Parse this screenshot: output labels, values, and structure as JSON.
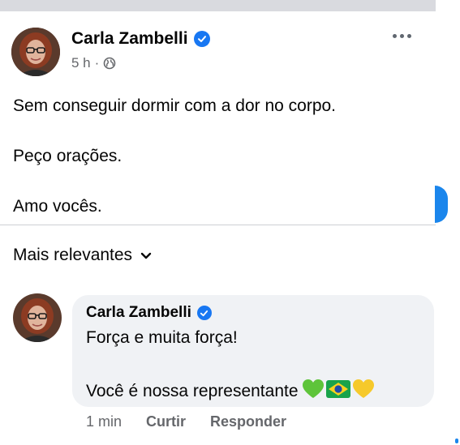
{
  "post": {
    "author": "Carla Zambelli",
    "time": "5 h",
    "separator": "·",
    "lines": [
      "Sem conseguir dormir com a dor no corpo.",
      "Peço orações.",
      "Amo vocês."
    ]
  },
  "comments": {
    "sort_label": "Mais relevantes"
  },
  "comment": {
    "author": "Carla Zambelli",
    "line1": "Força e muita força!",
    "line2": "Você é nossa representante",
    "time": "1 min",
    "like_label": "Curtir",
    "reply_label": "Responder"
  },
  "icons": {
    "verified": "verified-badge-icon",
    "audience": "globe-icon",
    "more": "more-options-icon",
    "sort": "chevron-down-icon",
    "emojis": [
      "green-heart-emoji",
      "brazil-flag-emoji",
      "yellow-heart-emoji"
    ]
  },
  "colors": {
    "accent": "#1877f2",
    "muted": "#65676b",
    "bubble": "#f0f2f5",
    "topbar": "#d9dadf"
  }
}
